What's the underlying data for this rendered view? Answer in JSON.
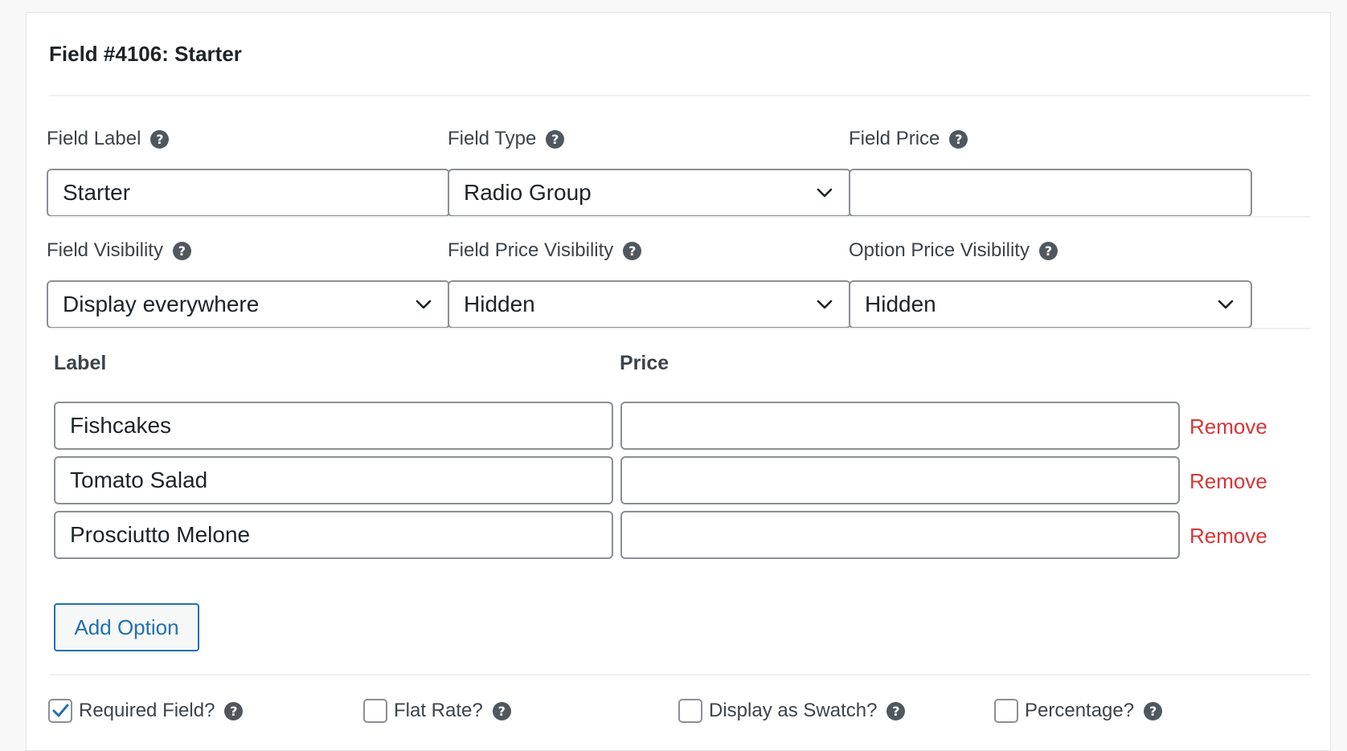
{
  "header": {
    "title": "Field #4106: Starter"
  },
  "fields": {
    "label": {
      "caption": "Field Label",
      "value": "Starter"
    },
    "type": {
      "caption": "Field Type",
      "value": "Radio Group"
    },
    "price": {
      "caption": "Field Price",
      "value": ""
    },
    "visibility": {
      "caption": "Field Visibility",
      "value": "Display everywhere"
    },
    "price_visibility": {
      "caption": "Field Price Visibility",
      "value": "Hidden"
    },
    "option_price_visibility": {
      "caption": "Option Price Visibility",
      "value": "Hidden"
    }
  },
  "options_table": {
    "label_header": "Label",
    "price_header": "Price",
    "remove_label": "Remove",
    "rows": [
      {
        "label": "Fishcakes",
        "price": ""
      },
      {
        "label": "Tomato Salad",
        "price": ""
      },
      {
        "label": "Prosciutto Melone",
        "price": ""
      }
    ],
    "add_label": "Add Option"
  },
  "checkboxes": [
    {
      "label": "Required Field?",
      "checked": true
    },
    {
      "label": "Flat Rate?",
      "checked": false
    },
    {
      "label": "Display as Swatch?",
      "checked": false
    },
    {
      "label": "Percentage?",
      "checked": false
    }
  ],
  "help_glyph": "?",
  "colors": {
    "accent": "#2271b1",
    "danger": "#d63638",
    "border": "#8c8f94"
  }
}
